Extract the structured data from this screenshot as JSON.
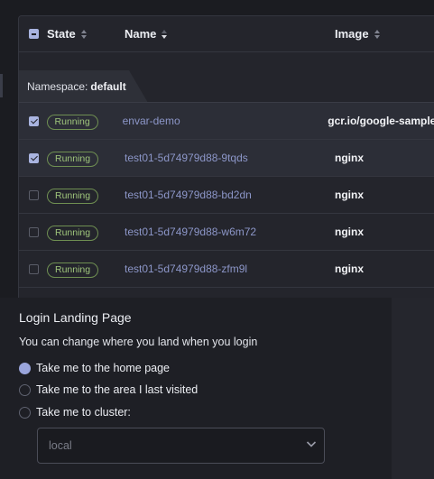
{
  "table": {
    "columns": {
      "state": "State",
      "name": "Name",
      "image": "Image"
    },
    "group": {
      "label": "Namespace:",
      "value": "default"
    },
    "rows": [
      {
        "selected": true,
        "state": "Running",
        "name": "envar-demo",
        "image": "gcr.io/google-samples"
      },
      {
        "selected": true,
        "state": "Running",
        "name": "test01-5d74979d88-9tqds",
        "image": "nginx"
      },
      {
        "selected": false,
        "state": "Running",
        "name": "test01-5d74979d88-bd2dn",
        "image": "nginx"
      },
      {
        "selected": false,
        "state": "Running",
        "name": "test01-5d74979d88-w6m72",
        "image": "nginx"
      },
      {
        "selected": false,
        "state": "Running",
        "name": "test01-5d74979d88-zfm9l",
        "image": "nginx"
      }
    ]
  },
  "prefs": {
    "title": "Login Landing Page",
    "subtitle": "You can change where you land when you login",
    "options": [
      {
        "label": "Take me to the home page",
        "selected": true
      },
      {
        "label": "Take me to the area I last visited",
        "selected": false
      },
      {
        "label": "Take me to cluster:",
        "selected": false
      }
    ],
    "cluster_select": {
      "value": "local"
    }
  },
  "colors": {
    "accent": "#a9b4e0",
    "running_badge": "#9ec47b",
    "link": "#8c96c8"
  },
  "icons": {
    "select_all": "checkbox-partial-icon",
    "sort": "sort-icon",
    "dropdown": "chevron-down-icon"
  }
}
